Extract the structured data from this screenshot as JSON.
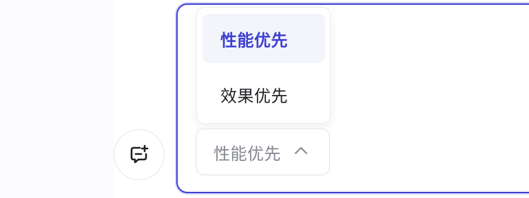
{
  "icons": {
    "new_chat": "chat-plus-icon",
    "chevron": "chevron-up-icon"
  },
  "colors": {
    "accent": "#3d3fd1",
    "selected_bg": "#f4f5fa",
    "select_text": "#83868f"
  },
  "mode_select": {
    "value": "性能优先"
  },
  "menu": {
    "items": [
      {
        "label": "性能优先",
        "selected": true
      },
      {
        "label": "效果优先",
        "selected": false
      }
    ]
  }
}
